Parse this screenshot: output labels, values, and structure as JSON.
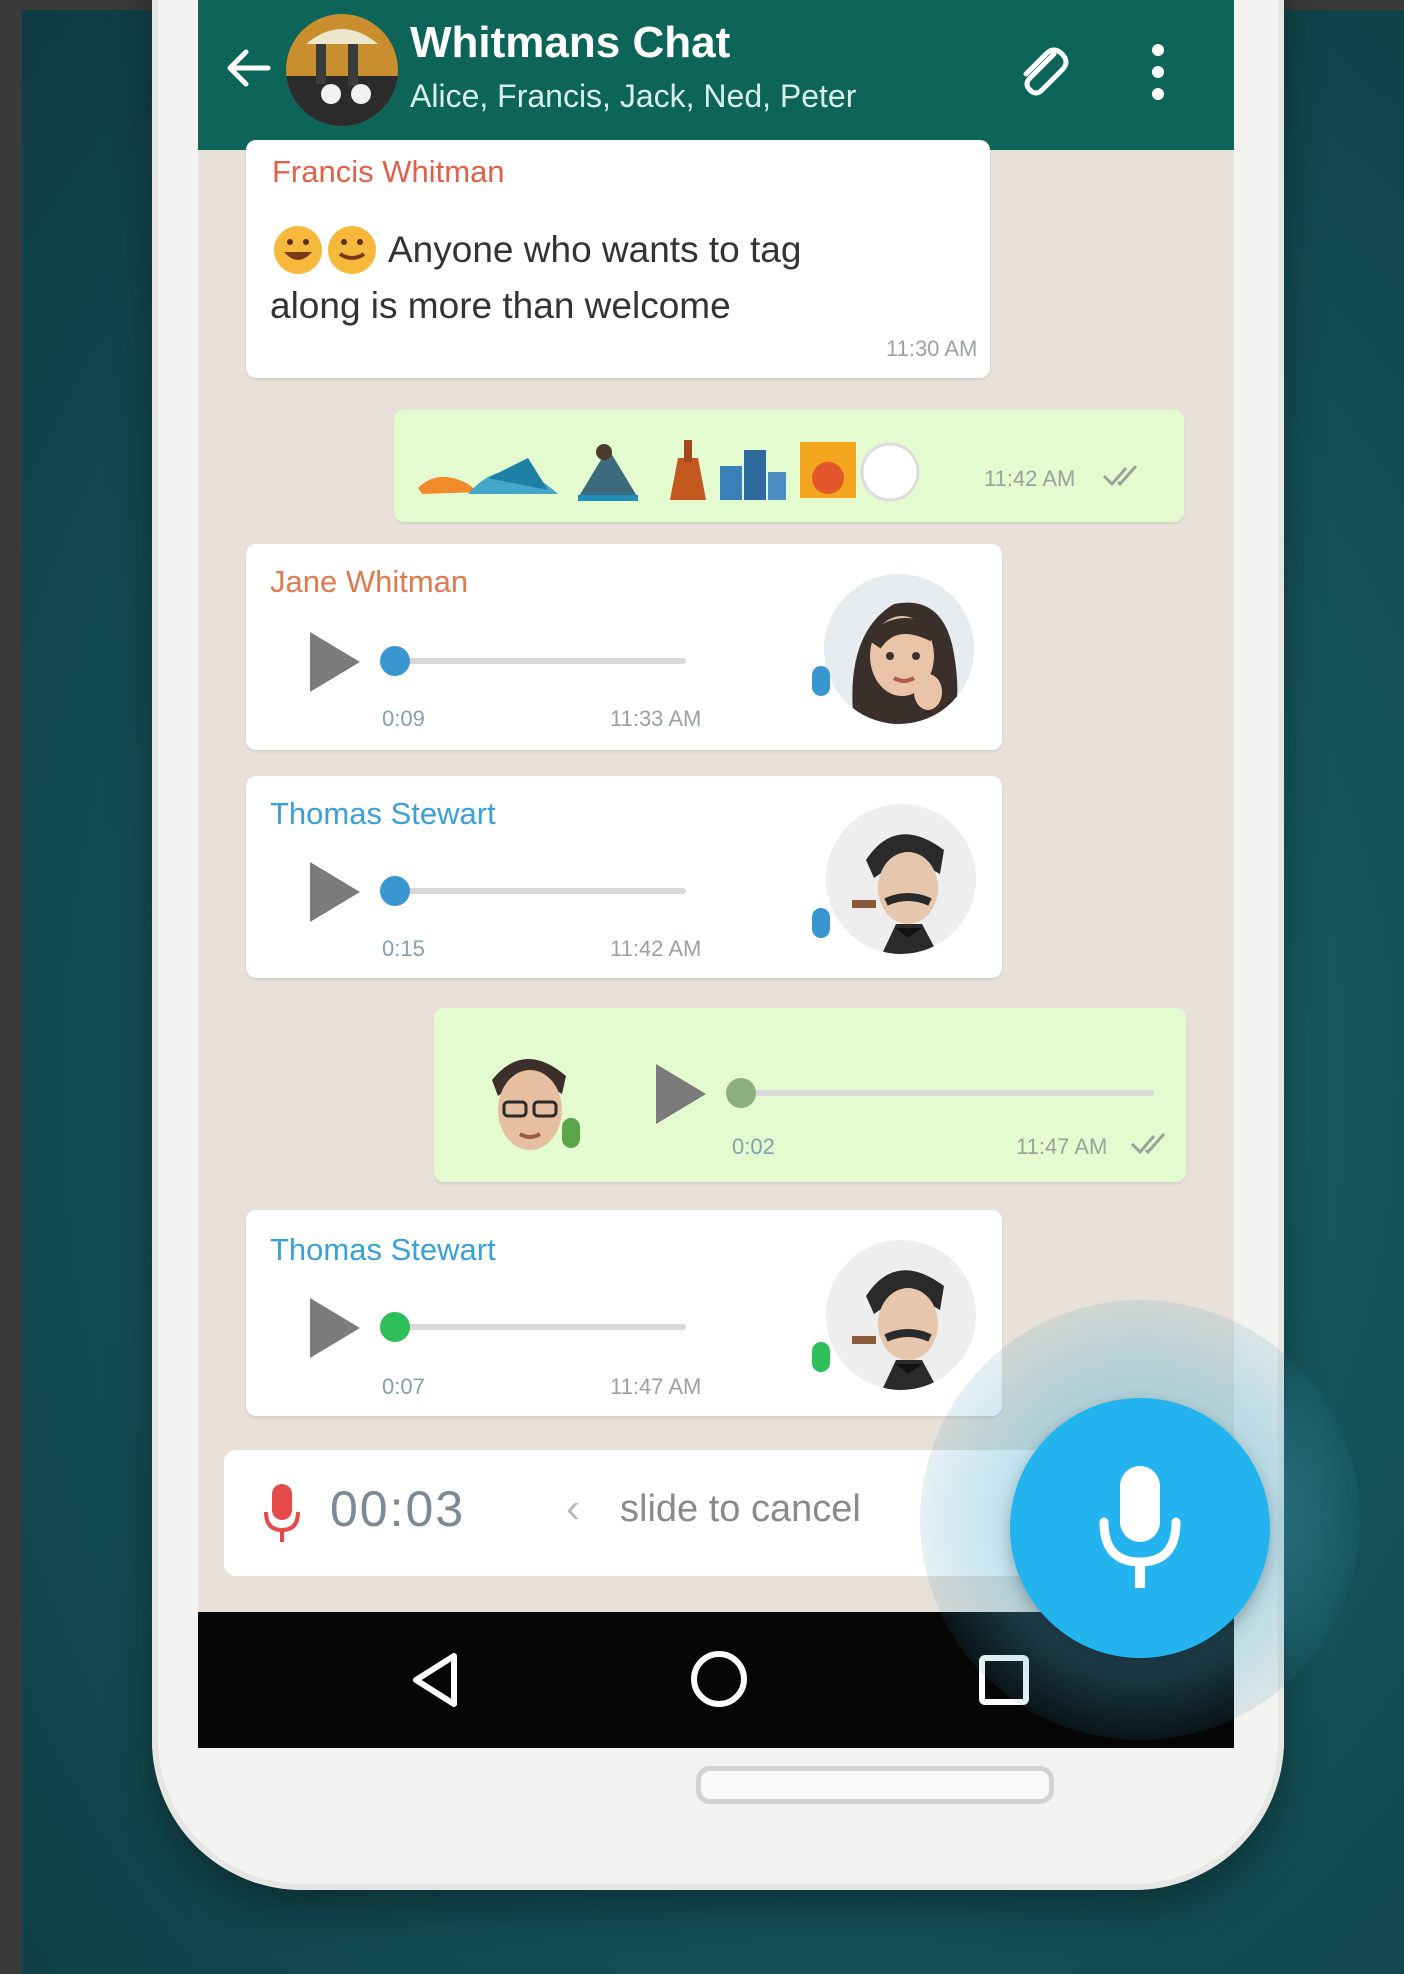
{
  "header": {
    "title": "Whitmans Chat",
    "members": "Alice, Francis, Jack, Ned, Peter"
  },
  "messages": [
    {
      "kind": "text",
      "direction": "in",
      "sender": "Francis Whitman",
      "text_line1": "Anyone who wants to tag",
      "text_line2": "along is more than welcome",
      "time": "11:30 AM"
    },
    {
      "kind": "emoji",
      "direction": "out",
      "time": "11:42 AM"
    },
    {
      "kind": "voice",
      "direction": "in",
      "sender": "Jane Whitman",
      "duration": "0:09",
      "time": "11:33 AM"
    },
    {
      "kind": "voice",
      "direction": "in",
      "sender": "Thomas Stewart",
      "duration": "0:15",
      "time": "11:42 AM"
    },
    {
      "kind": "voice",
      "direction": "out",
      "duration": "0:02",
      "time": "11:47 AM"
    },
    {
      "kind": "voice",
      "direction": "in",
      "sender": "Thomas Stewart",
      "duration": "0:07",
      "time": "11:47 AM"
    }
  ],
  "recording": {
    "timer": "00:03",
    "hint": "slide to cancel"
  },
  "colors": {
    "header": "#0d6559",
    "outgoing_bubble": "#e3fbcf",
    "mic_button": "#23b4ef"
  },
  "icons": {
    "back": "arrow-left-icon",
    "attach": "paperclip-icon",
    "menu": "more-vert-icon",
    "record": "mic-icon",
    "nav_back": "triangle-back-icon",
    "nav_home": "circle-home-icon",
    "nav_recents": "square-recents-icon"
  }
}
